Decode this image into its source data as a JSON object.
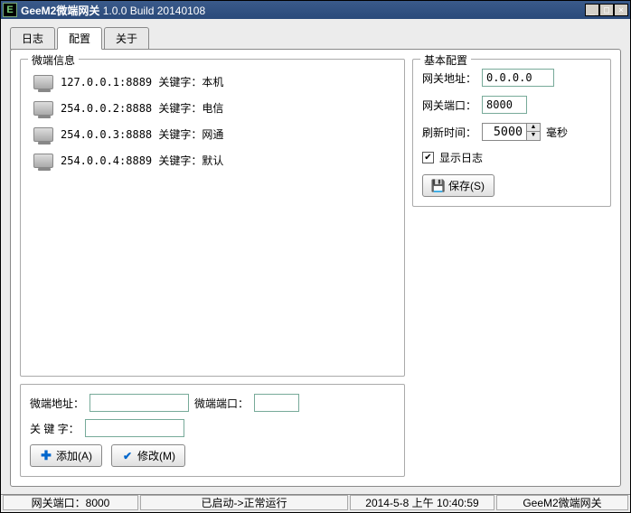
{
  "title": {
    "app": "GeeM2微端网关",
    "version": "1.0.0 Build 20140108",
    "icon_letter": "E"
  },
  "winbtns": {
    "min": "_",
    "max": "□",
    "close": "×"
  },
  "tabs": [
    {
      "label": "日志",
      "active": false
    },
    {
      "label": "配置",
      "active": true
    },
    {
      "label": "关于",
      "active": false
    }
  ],
  "microinfo": {
    "title": "微端信息",
    "items": [
      {
        "text": "127.0.0.1:8889 关键字：本机"
      },
      {
        "text": "254.0.0.2:8888 关键字：电信"
      },
      {
        "text": "254.0.0.3:8888 关键字：网通"
      },
      {
        "text": "254.0.0.4:8889 关键字：默认"
      }
    ]
  },
  "editform": {
    "addr_label": "微端地址：",
    "addr_value": "",
    "port_label": "微端端口：",
    "port_value": "",
    "key_label": "关 键 字：",
    "key_value": "",
    "btn_add": "添加(A)",
    "btn_edit": "修改(M)"
  },
  "config": {
    "title": "基本配置",
    "gw_addr_label": "网关地址：",
    "gw_addr_value": "0.0.0.0",
    "gw_port_label": "网关端口：",
    "gw_port_value": "8000",
    "refresh_label": "刷新时间：",
    "refresh_value": "5000",
    "refresh_unit": "毫秒",
    "showlog_checked": "✔",
    "showlog_label": "显示日志",
    "btn_save": "保存(S)"
  },
  "status": {
    "port": "网关端口：8000",
    "state": "已启动->正常运行",
    "time": "2014-5-8 上午 10:40:59",
    "brand": "GeeM2微端网关"
  }
}
